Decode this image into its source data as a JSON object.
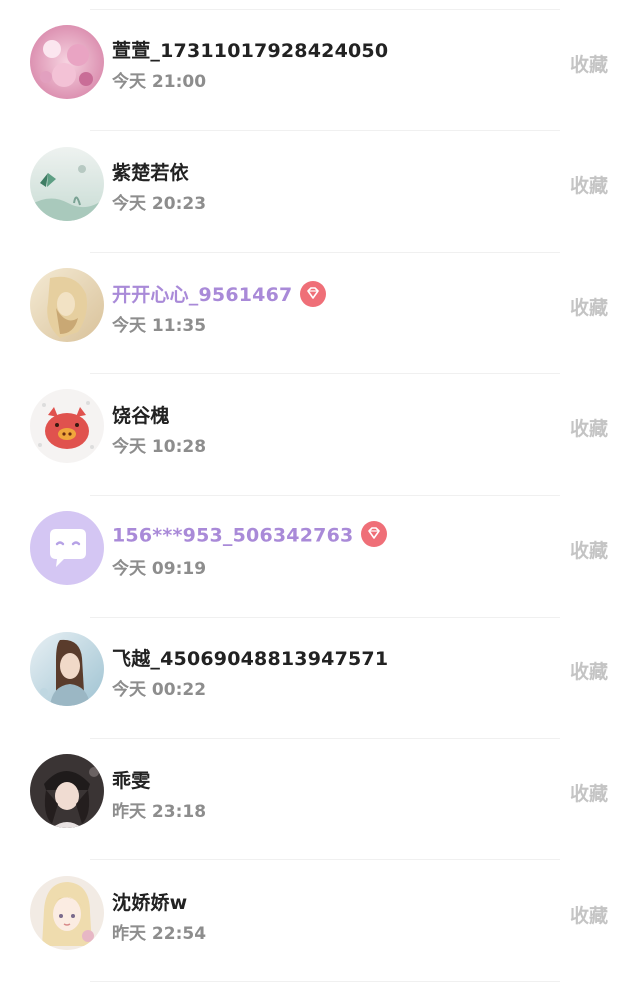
{
  "colors": {
    "name": "#222222",
    "vip_name": "#a98ad8",
    "vip_badge": "#ef6f78",
    "time": "#8d8d8d",
    "favorite": "#c4c4c4"
  },
  "users": [
    {
      "name": "萱萱_17311017928424050",
      "time": "今天 21:00",
      "vip": false,
      "action": "收藏",
      "avatar": "avatar-photo-pink-icon"
    },
    {
      "name": "紫楚若依",
      "time": "今天 20:23",
      "vip": false,
      "action": "收藏",
      "avatar": "avatar-photo-butterfly-icon"
    },
    {
      "name": "开开心心_9561467",
      "time": "今天 11:35",
      "vip": true,
      "action": "收藏",
      "avatar": "avatar-photo-girl-icon"
    },
    {
      "name": "饶谷槐",
      "time": "今天 10:28",
      "vip": false,
      "action": "收藏",
      "avatar": "avatar-pig-cartoon-icon"
    },
    {
      "name": "156***953_506342763",
      "time": "今天 09:19",
      "vip": true,
      "action": "收藏",
      "avatar": "avatar-default-chat-icon"
    },
    {
      "name": "飞越_45069048813947571",
      "time": "今天 00:22",
      "vip": false,
      "action": "收藏",
      "avatar": "avatar-photo-girl-icon"
    },
    {
      "name": "乖雯",
      "time": "昨天 23:18",
      "vip": false,
      "action": "收藏",
      "avatar": "avatar-photo-girl-hat-icon"
    },
    {
      "name": "沈娇娇w",
      "time": "昨天 22:54",
      "vip": false,
      "action": "收藏",
      "avatar": "avatar-anime-girl-icon"
    }
  ]
}
